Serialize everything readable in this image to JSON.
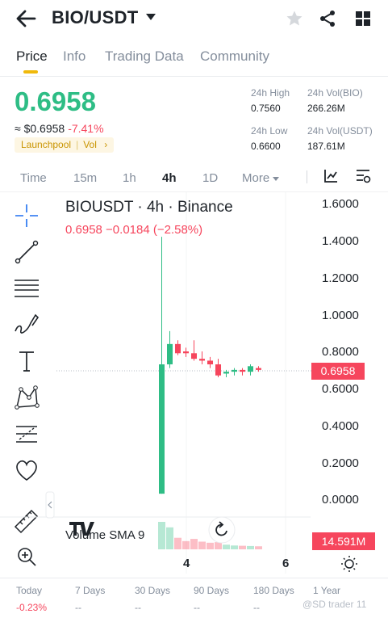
{
  "header": {
    "pair": "BIO/USDT",
    "icons": [
      "back-arrow-icon",
      "caret-down-icon",
      "star-icon",
      "share-icon",
      "grid-icon"
    ]
  },
  "tabs": [
    {
      "label": "Price",
      "active": true
    },
    {
      "label": "Info",
      "active": false
    },
    {
      "label": "Trading Data",
      "active": false
    },
    {
      "label": "Community",
      "active": false
    }
  ],
  "price": {
    "last": "0.6958",
    "usd": "≈ $0.6958",
    "change_pct": "-7.41%",
    "badge_left": "Launchpool",
    "badge_right": "Vol",
    "badge_arrow": "›"
  },
  "stats": {
    "high_label": "24h High",
    "high_value": "0.7560",
    "low_label": "24h Low",
    "low_value": "0.6600",
    "vol_base_label": "24h Vol(BIO)",
    "vol_base_value": "266.26M",
    "vol_quote_label": "24h Vol(USDT)",
    "vol_quote_value": "187.61M"
  },
  "intervals": [
    {
      "label": "Time",
      "active": false
    },
    {
      "label": "15m",
      "active": false
    },
    {
      "label": "1h",
      "active": false
    },
    {
      "label": "4h",
      "active": true
    },
    {
      "label": "1D",
      "active": false
    },
    {
      "label": "More",
      "active": false
    }
  ],
  "tools": [
    "crosshair-icon",
    "trend-line-icon",
    "fib-lines-icon",
    "brush-icon",
    "text-tool-icon",
    "pattern-icon",
    "prediction-icon",
    "favorite-heart-icon",
    "ruler-icon",
    "zoom-in-icon"
  ],
  "chart": {
    "title": "BIOUSDT · 4h · Binance",
    "ohlc_change": "0.6958  −0.0184 (−2.58%)",
    "last_price_tag": "0.6958",
    "volume_label": "Volume  SMA 9",
    "volume_tag": "14.591M",
    "y_ticks": [
      "1.6000",
      "1.4000",
      "1.2000",
      "1.0000",
      "0.8000",
      "0.6000",
      "0.4000",
      "0.2000",
      "0.0000"
    ],
    "x_ticks": [
      "4",
      "6"
    ],
    "up_color": "#2ebd85",
    "down_color": "#f6465d"
  },
  "chart_data": {
    "type": "candlestick",
    "title": "BIOUSDT · 4h · Binance",
    "ylim": [
      0,
      1.6
    ],
    "candles": [
      {
        "open": 0.03,
        "high": 1.42,
        "low": 0.03,
        "close": 0.73,
        "volume": 1.0
      },
      {
        "open": 0.73,
        "high": 0.91,
        "low": 0.71,
        "close": 0.84,
        "volume": 0.8
      },
      {
        "open": 0.84,
        "high": 0.86,
        "low": 0.78,
        "close": 0.79,
        "volume": 0.42
      },
      {
        "open": 0.8,
        "high": 0.82,
        "low": 0.77,
        "close": 0.79,
        "volume": 0.3
      },
      {
        "open": 0.79,
        "high": 0.86,
        "low": 0.75,
        "close": 0.76,
        "volume": 0.38
      },
      {
        "open": 0.76,
        "high": 0.8,
        "low": 0.73,
        "close": 0.75,
        "volume": 0.28
      },
      {
        "open": 0.75,
        "high": 0.77,
        "low": 0.71,
        "close": 0.73,
        "volume": 0.24
      },
      {
        "open": 0.73,
        "high": 0.76,
        "low": 0.66,
        "close": 0.67,
        "volume": 0.26
      },
      {
        "open": 0.68,
        "high": 0.7,
        "low": 0.66,
        "close": 0.69,
        "volume": 0.17
      },
      {
        "open": 0.69,
        "high": 0.71,
        "low": 0.67,
        "close": 0.7,
        "volume": 0.14
      },
      {
        "open": 0.7,
        "high": 0.71,
        "low": 0.67,
        "close": 0.69,
        "volume": 0.13
      },
      {
        "open": 0.69,
        "high": 0.73,
        "low": 0.67,
        "close": 0.72,
        "volume": 0.12
      },
      {
        "open": 0.71,
        "high": 0.72,
        "low": 0.69,
        "close": 0.7,
        "volume": 0.11
      }
    ]
  },
  "performance": [
    {
      "label": "Today",
      "value": "-0.23%",
      "negative": true
    },
    {
      "label": "7 Days",
      "value": "--",
      "negative": false
    },
    {
      "label": "30 Days",
      "value": "--",
      "negative": false
    },
    {
      "label": "90 Days",
      "value": "--",
      "negative": false
    },
    {
      "label": "180 Days",
      "value": "--",
      "negative": false
    },
    {
      "label": "1 Year",
      "value": "--",
      "negative": false
    }
  ],
  "watermark": "@SD trader 11"
}
